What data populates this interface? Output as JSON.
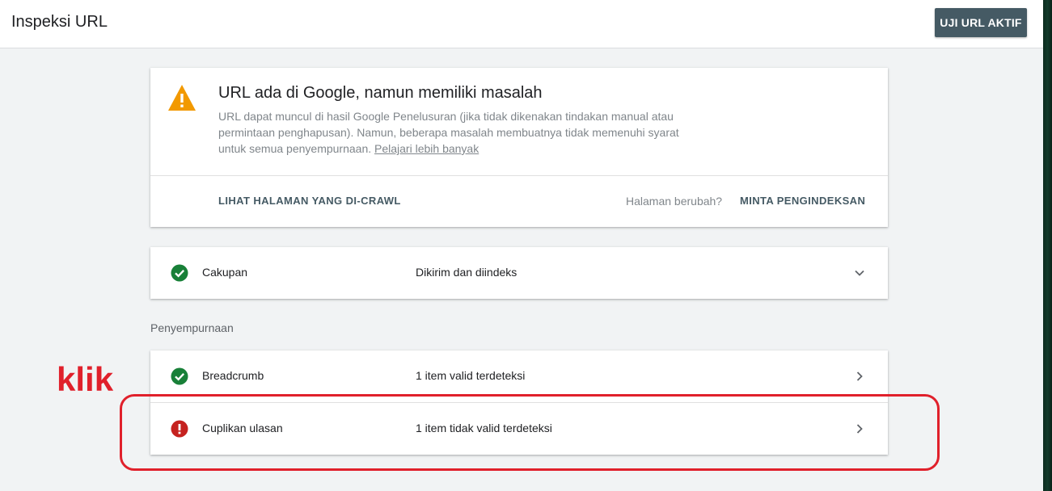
{
  "header": {
    "title": "Inspeksi URL",
    "test_live_label": "UJI URL AKTIF"
  },
  "status": {
    "icon": "warning-icon",
    "title": "URL ada di Google, namun memiliki masalah",
    "description": "URL dapat muncul di hasil Google Penelusuran (jika tidak dikenakan tindakan manual atau permintaan penghapusan). Namun, beberapa masalah membuatnya tidak memenuhi syarat untuk semua penyempurnaan.",
    "learn_more": "Pelajari lebih banyak",
    "view_crawled_label": "LIHAT HALAMAN YANG DI-CRAWL",
    "page_changed_label": "Halaman berubah?",
    "request_indexing_label": "MINTA PENGINDEKSAN"
  },
  "coverage": {
    "label": "Cakupan",
    "value": "Dikirim dan diindeks",
    "icon": "check-circle-icon"
  },
  "enhancements": {
    "section_label": "Penyempurnaan",
    "items": [
      {
        "label": "Breadcrumb",
        "value": "1 item valid terdeteksi",
        "icon": "check-circle-icon"
      },
      {
        "label": "Cuplikan ulasan",
        "value": "1 item tidak valid terdeteksi",
        "icon": "error-circle-icon"
      }
    ]
  },
  "annotation": {
    "text": "klik"
  },
  "colors": {
    "success": "#188038",
    "error": "#c5221f",
    "warning": "#f29900",
    "button": "#455a64",
    "annotation": "#e0202b"
  }
}
